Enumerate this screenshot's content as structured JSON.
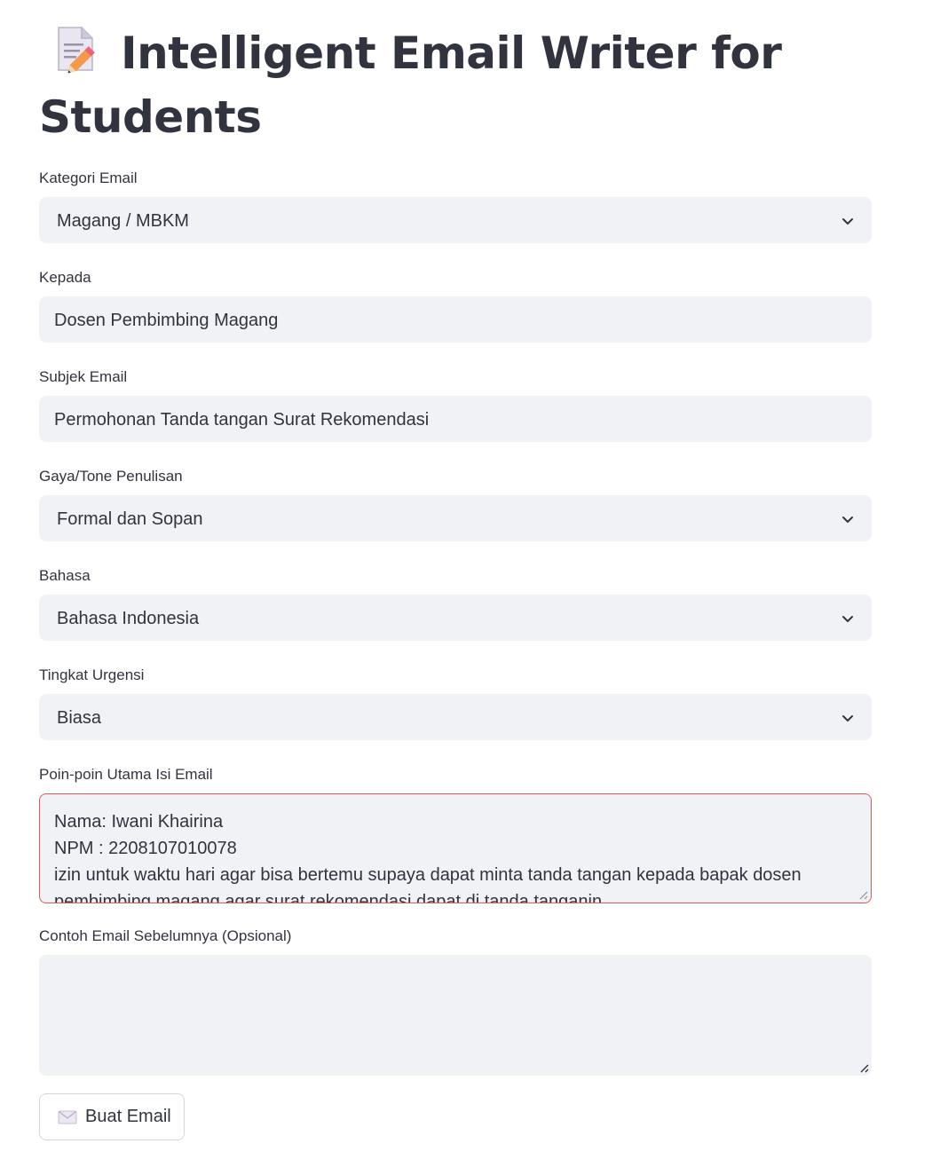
{
  "header": {
    "title_icon": "memo-pencil-icon",
    "title": "Intelligent Email Writer for Students"
  },
  "form": {
    "category": {
      "label": "Kategori Email",
      "value": "Magang / MBKM"
    },
    "recipient": {
      "label": "Kepada",
      "value": "Dosen Pembimbing Magang"
    },
    "subject": {
      "label": "Subjek Email",
      "value": "Permohonan Tanda tangan Surat Rekomendasi"
    },
    "tone": {
      "label": "Gaya/Tone Penulisan",
      "value": "Formal dan Sopan"
    },
    "language": {
      "label": "Bahasa",
      "value": "Bahasa Indonesia"
    },
    "urgency": {
      "label": "Tingkat Urgensi",
      "value": "Biasa"
    },
    "points": {
      "label": "Poin-poin Utama Isi Email",
      "value": "Nama: Iwani Khairina\nNPM : 2208107010078\nizin untuk waktu hari agar bisa bertemu supaya dapat minta tanda tangan kepada bapak dosen pembimbing magang agar surat rekomendasi dapat di tanda tanganin"
    },
    "previous_example": {
      "label": "Contoh Email Sebelumnya (Opsional)",
      "value": ""
    },
    "submit": {
      "icon": "envelope-icon",
      "label": "Buat Email"
    }
  },
  "colors": {
    "text": "#31333f",
    "field_background": "#f0f2f6",
    "error_border": "#e05a5a"
  }
}
